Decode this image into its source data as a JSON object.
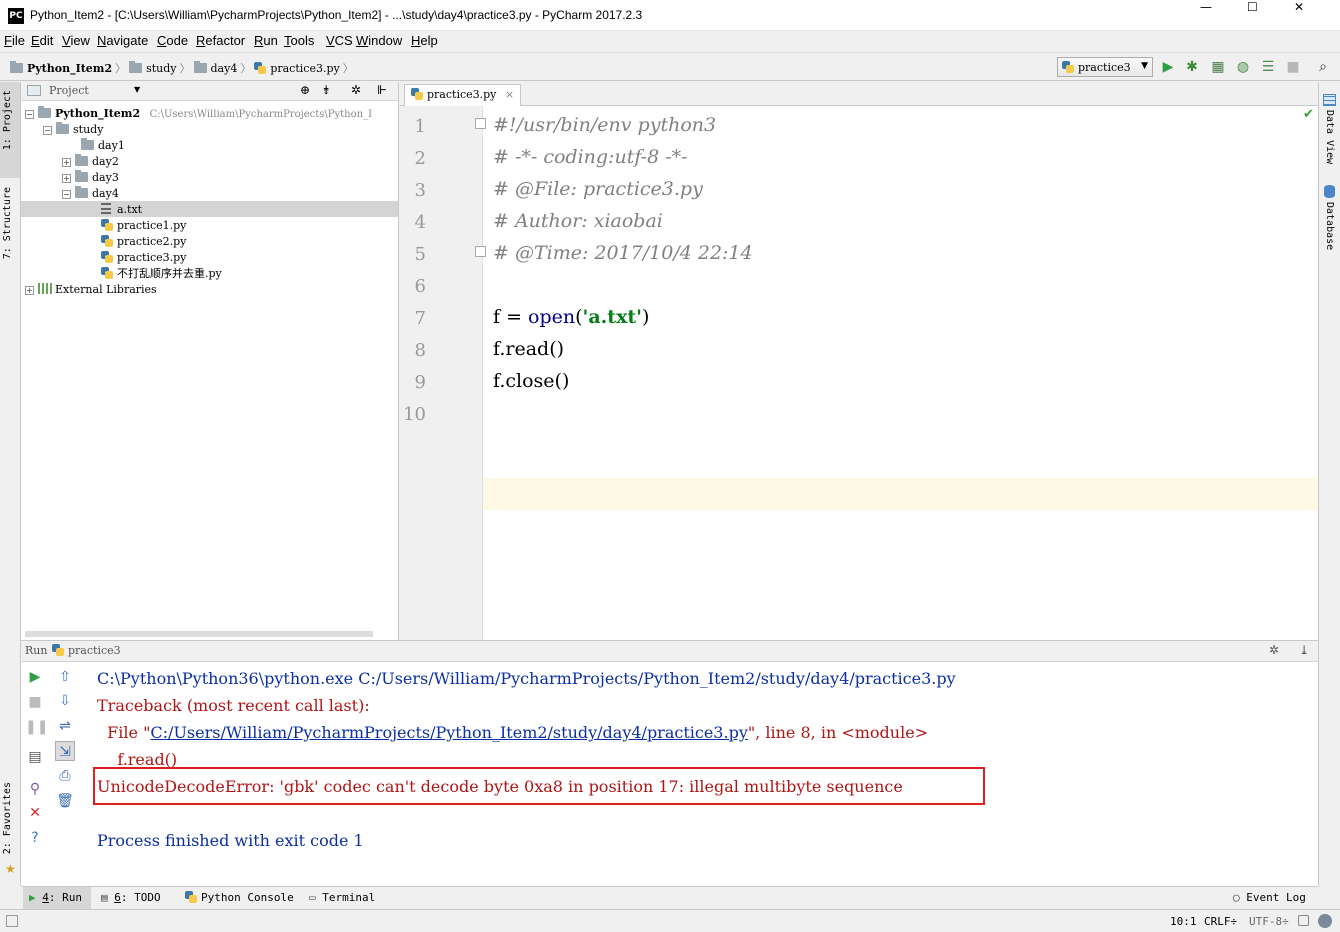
{
  "window": {
    "title": "Python_Item2 - [C:\\Users\\William\\PycharmProjects\\Python_Item2] - ...\\study\\day4\\practice3.py - PyCharm 2017.2.3",
    "logo": "PC",
    "controls": {
      "minimize": "—",
      "maximize": "☐",
      "close": "✕"
    }
  },
  "menu": [
    "File",
    "Edit",
    "View",
    "Navigate",
    "Code",
    "Refactor",
    "Run",
    "Tools",
    "VCS",
    "Window",
    "Help"
  ],
  "breadcrumb": [
    "Python_Item2",
    "study",
    "day4",
    "practice3.py"
  ],
  "run_config": {
    "name": "practice3"
  },
  "toolbar_icons": [
    "run-icon",
    "debug-icon",
    "coverage-icon",
    "profile-icon",
    "concurrency-icon",
    "stop-icon",
    "search-icon"
  ],
  "left_strip": {
    "project": "1: Project",
    "structure": "7: Structure",
    "favorites": "2: Favorites"
  },
  "right_strip": {
    "data_view": "Data View",
    "database": "Database"
  },
  "project_panel": {
    "header": "Project",
    "root": {
      "name": "Python_Item2",
      "path": "C:\\Users\\William\\PycharmProjects\\Python_I"
    },
    "tree": [
      {
        "label": "study",
        "kind": "folder",
        "expander": "−"
      },
      {
        "label": "day1",
        "kind": "folder",
        "expander": ""
      },
      {
        "label": "day2",
        "kind": "folder",
        "expander": "+"
      },
      {
        "label": "day3",
        "kind": "folder",
        "expander": "+"
      },
      {
        "label": "day4",
        "kind": "folder",
        "expander": "−"
      },
      {
        "label": "a.txt",
        "kind": "text",
        "selected": true
      },
      {
        "label": "practice1.py",
        "kind": "python"
      },
      {
        "label": "practice2.py",
        "kind": "python"
      },
      {
        "label": "practice3.py",
        "kind": "python"
      },
      {
        "label": "不打乱顺序并去重.py",
        "kind": "python"
      }
    ],
    "external": "External Libraries"
  },
  "editor": {
    "tab": "practice3.py",
    "tab_close": "×",
    "line_numbers": [
      "1",
      "2",
      "3",
      "4",
      "5",
      "6",
      "7",
      "8",
      "9",
      "10"
    ],
    "lines": {
      "l1": "#!/usr/bin/env python3",
      "l2": "# -*- coding:utf-8 -*-",
      "l3": "# @File: practice3.py",
      "l4": "# Author: xiaobai",
      "l5": "# @Time: 2017/10/4 22:14",
      "l7_a": "f = ",
      "l7_fn": "open",
      "l7_b": "(",
      "l7_str": "'a.txt'",
      "l7_c": ")",
      "l8": "f.read()",
      "l9": "f.close()"
    },
    "check_mark": "✔"
  },
  "run_panel": {
    "label": "Run",
    "config": "practice3",
    "output": {
      "cmd": "C:\\Python\\Python36\\python.exe C:/Users/William/PycharmProjects/Python_Item2/study/day4/practice3.py",
      "traceback": "Traceback (most recent call last):",
      "file_prefix": "  File \"",
      "file_link": "C:/Users/William/PycharmProjects/Python_Item2/study/day4/practice3.py",
      "file_suffix": "\", line 8, in <module>",
      "code": "    f.read()",
      "error": "UnicodeDecodeError: 'gbk' codec can't decode byte 0xa8 in position 17: illegal multibyte sequence",
      "finished": "Process finished with exit code 1"
    }
  },
  "bottom_tabs": {
    "run_num": "4",
    "run": ": Run",
    "todo_num": "6",
    "todo": ": TODO",
    "console": "Python Console",
    "terminal": "Terminal",
    "event_log": "Event Log"
  },
  "status": {
    "position": "10:1",
    "line_sep": "CRLF÷",
    "encoding": "UTF-8÷"
  },
  "colors": {
    "comment": "#808080",
    "string": "#067d17",
    "error": "#b01515",
    "output_blue": "#0b2fa3",
    "highlight_box": "#e01f1f",
    "current_line": "#fdf9e4"
  }
}
